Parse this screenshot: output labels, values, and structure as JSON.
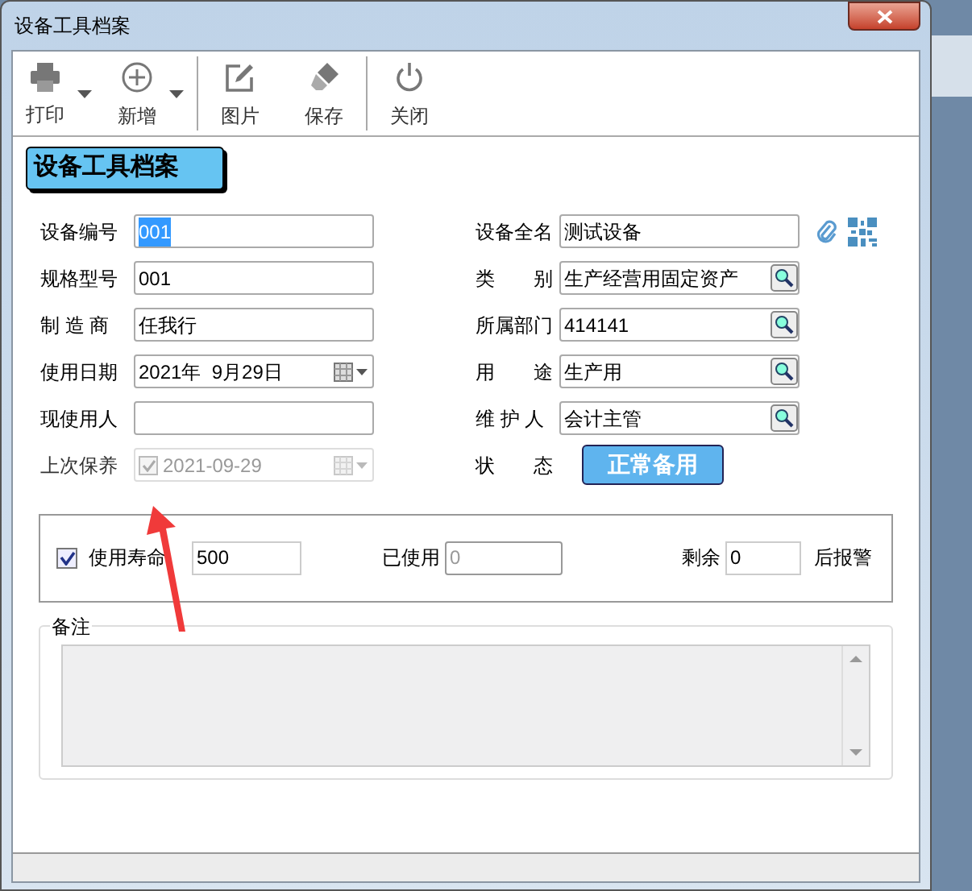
{
  "window": {
    "title": "设备工具档案"
  },
  "toolbar": [
    {
      "label": "打印",
      "kind": "print",
      "dropdown": true,
      "group_end": false
    },
    {
      "label": "新增",
      "kind": "add",
      "dropdown": true,
      "group_end": true
    },
    {
      "label": "图片",
      "kind": "image",
      "dropdown": false,
      "group_end": false
    },
    {
      "label": "保存",
      "kind": "save",
      "dropdown": false,
      "group_end": true
    },
    {
      "label": "关闭",
      "kind": "close",
      "dropdown": false,
      "group_end": false
    }
  ],
  "header": "设备工具档案",
  "left_fields": [
    {
      "label": "设备编号",
      "value": "001",
      "kind": "text",
      "text_selected": true
    },
    {
      "label": "规格型号",
      "value": "001",
      "kind": "text"
    },
    {
      "label": "制 造 商",
      "value": "任我行",
      "kind": "text"
    },
    {
      "label": "使用日期",
      "value": "2021年  9月29日",
      "kind": "date",
      "disabled": false
    },
    {
      "label": "现使用人",
      "kind": "text"
    },
    {
      "label": "上次保养",
      "value": "2021-09-29",
      "kind": "checkdate",
      "checked": true,
      "disabled": true
    }
  ],
  "right_fields": [
    {
      "label": "设备全名",
      "value": "测试设备",
      "kind": "text"
    },
    {
      "label": "类　　别",
      "value": "生产经营用固定资产",
      "kind": "lookup"
    },
    {
      "label": "所属部门",
      "value": "414141",
      "kind": "lookup"
    },
    {
      "label": "用　　途",
      "value": "生产用",
      "kind": "lookup"
    },
    {
      "label": "维 护 人",
      "value": "会计主管",
      "kind": "lookup"
    },
    {
      "label": "状　　态",
      "value": "正常备用",
      "kind": "status"
    }
  ],
  "life": {
    "checked": true,
    "label": "使用寿命",
    "value": "500",
    "used_label": "已使用",
    "used_value": "0",
    "remaining_label": "剩余",
    "remaining_value": "0",
    "suffix": "后报警"
  },
  "remarks": {
    "label": "备注"
  }
}
